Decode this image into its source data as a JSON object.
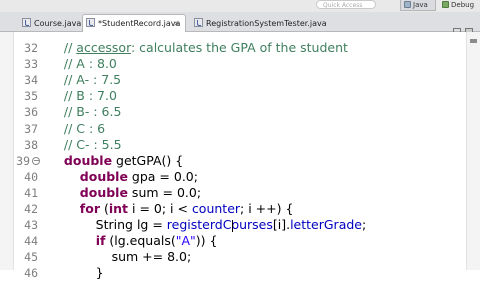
{
  "toolbar": {
    "search_placeholder": "Quick Access",
    "perspectives": [
      {
        "label": "Java",
        "icon": "java-perspective-icon",
        "active": true
      },
      {
        "label": "Debug",
        "icon": "debug-perspective-icon",
        "active": false
      }
    ]
  },
  "tabs": [
    {
      "label": "Course.java",
      "icon": "java-file-icon"
    },
    {
      "label": "*StudentRecord.java",
      "icon": "java-file-icon",
      "active": true,
      "close": "×"
    },
    {
      "label": "RegistrationSystemTester.java",
      "icon": "java-file-icon"
    }
  ],
  "editor": {
    "lines": [
      {
        "num": "32",
        "tokens": [
          {
            "t": "    // ",
            "c": "comment"
          },
          {
            "t": "accessor",
            "c": "comment-u"
          },
          {
            "t": ": calculates the GPA of the student",
            "c": "comment"
          }
        ]
      },
      {
        "num": "33",
        "tokens": [
          {
            "t": "    // A : 8.0",
            "c": "comment"
          }
        ]
      },
      {
        "num": "34",
        "tokens": [
          {
            "t": "    // A- : 7.5",
            "c": "comment"
          }
        ]
      },
      {
        "num": "35",
        "tokens": [
          {
            "t": "    // B : 7.0",
            "c": "comment"
          }
        ]
      },
      {
        "num": "36",
        "tokens": [
          {
            "t": "    // B- : 6.5",
            "c": "comment"
          }
        ]
      },
      {
        "num": "37",
        "tokens": [
          {
            "t": "    // C : 6",
            "c": "comment"
          }
        ]
      },
      {
        "num": "38",
        "tokens": [
          {
            "t": "    // C- : 5.5",
            "c": "comment"
          }
        ]
      },
      {
        "num": "39",
        "fold": "−",
        "tokens": [
          {
            "t": "    ",
            "c": "plain"
          },
          {
            "t": "double",
            "c": "kw"
          },
          {
            "t": " getGPA() {",
            "c": "plain"
          }
        ]
      },
      {
        "num": "40",
        "tokens": [
          {
            "t": "        ",
            "c": "plain"
          },
          {
            "t": "double",
            "c": "kw"
          },
          {
            "t": " gpa = 0.0;",
            "c": "plain"
          }
        ]
      },
      {
        "num": "41",
        "tokens": [
          {
            "t": "        ",
            "c": "plain"
          },
          {
            "t": "double",
            "c": "kw"
          },
          {
            "t": " sum = 0.0;",
            "c": "plain"
          }
        ]
      },
      {
        "num": "42",
        "tokens": [
          {
            "t": "        ",
            "c": "plain"
          },
          {
            "t": "for",
            "c": "kw"
          },
          {
            "t": " (",
            "c": "plain"
          },
          {
            "t": "int",
            "c": "kw"
          },
          {
            "t": " i = 0; i < ",
            "c": "plain"
          },
          {
            "t": "counter",
            "c": "field"
          },
          {
            "t": "; i ++) {",
            "c": "plain"
          }
        ]
      },
      {
        "num": "43",
        "tokens": [
          {
            "t": "            String lg = ",
            "c": "plain"
          },
          {
            "t": "registerdCourses",
            "c": "field"
          },
          {
            "t": "[i].",
            "c": "plain"
          },
          {
            "t": "letterGrade",
            "c": "field"
          },
          {
            "t": ";",
            "c": "plain"
          }
        ]
      },
      {
        "num": "44",
        "tokens": [
          {
            "t": "            ",
            "c": "plain"
          },
          {
            "t": "if",
            "c": "kw"
          },
          {
            "t": " (lg.equals(",
            "c": "plain"
          },
          {
            "t": "\"A\"",
            "c": "str"
          },
          {
            "t": ")) {",
            "c": "plain"
          }
        ]
      },
      {
        "num": "45",
        "tokens": [
          {
            "t": "                sum += 8.0;",
            "c": "plain"
          }
        ]
      },
      {
        "num": "46",
        "tokens": [
          {
            "t": "            }",
            "c": "plain"
          }
        ]
      }
    ]
  }
}
